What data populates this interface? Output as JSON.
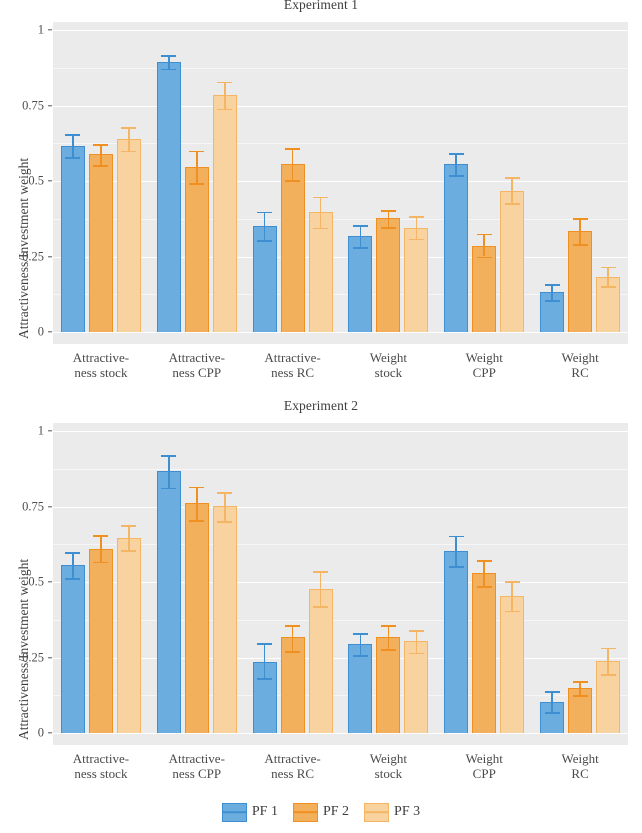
{
  "figure": {
    "panels": [
      {
        "title": "Experiment 1",
        "ylabel": "Attractiveness/Investment weight"
      },
      {
        "title": "Experiment 2",
        "ylabel": "Attractiveness/Investment weight"
      }
    ],
    "legend": {
      "items": [
        {
          "label": "PF 1",
          "color": "#6cade0",
          "border": "#3d8fd1"
        },
        {
          "label": "PF 2",
          "color": "#f2b05c",
          "border": "#ef9021"
        },
        {
          "label": "PF 3",
          "color": "#f8d3a0",
          "border": "#f4b665"
        }
      ]
    }
  },
  "chart_data": [
    {
      "type": "bar",
      "title": "Experiment 1",
      "xlabel": "",
      "ylabel": "Attractiveness/Investment weight",
      "ylim": [
        0,
        1
      ],
      "yticks": [
        0,
        0.25,
        0.5,
        0.75,
        1
      ],
      "ytick_labels": [
        "0",
        "0.25",
        "0.5",
        "0.75",
        "1"
      ],
      "grid": true,
      "legend_position": "bottom",
      "categories": [
        "Attractive-\nness stock",
        "Attractive-\nness CPP",
        "Attractive-\nness RC",
        "Weight\nstock",
        "Weight\nCPP",
        "Weight\nRC"
      ],
      "category_lines": [
        [
          "Attractive-",
          "ness stock"
        ],
        [
          "Attractive-",
          "ness CPP"
        ],
        [
          "Attractive-",
          "ness RC"
        ],
        [
          "Weight",
          "stock"
        ],
        [
          "Weight",
          "CPP"
        ],
        [
          "Weight",
          "RC"
        ]
      ],
      "series": [
        {
          "name": "PF 1",
          "color": "#6cade0",
          "border": "#3d8fd1",
          "values": [
            0.615,
            0.893,
            0.352,
            0.318,
            0.556,
            0.131
          ],
          "err_low": [
            0.578,
            0.872,
            0.303,
            0.281,
            0.519,
            0.105
          ],
          "err_high": [
            0.655,
            0.917,
            0.399,
            0.354,
            0.592,
            0.159
          ]
        },
        {
          "name": "PF 2",
          "color": "#f2b05c",
          "border": "#ef9021",
          "values": [
            0.589,
            0.547,
            0.556,
            0.377,
            0.286,
            0.334
          ],
          "err_low": [
            0.552,
            0.492,
            0.503,
            0.347,
            0.25,
            0.291
          ],
          "err_high": [
            0.622,
            0.6,
            0.609,
            0.404,
            0.325,
            0.377
          ]
        },
        {
          "name": "PF 3",
          "color": "#f8d3a0",
          "border": "#f4b665",
          "values": [
            0.639,
            0.784,
            0.397,
            0.346,
            0.468,
            0.183
          ],
          "err_low": [
            0.6,
            0.74,
            0.345,
            0.309,
            0.426,
            0.152
          ],
          "err_high": [
            0.678,
            0.829,
            0.448,
            0.384,
            0.512,
            0.216
          ]
        }
      ]
    },
    {
      "type": "bar",
      "title": "Experiment 2",
      "xlabel": "",
      "ylabel": "Attractiveness/Investment weight",
      "ylim": [
        0,
        1
      ],
      "yticks": [
        0,
        0.25,
        0.5,
        0.75,
        1
      ],
      "ytick_labels": [
        "0",
        "0.25",
        "0.5",
        "0.75",
        "1"
      ],
      "grid": true,
      "legend_position": "bottom",
      "categories": [
        "Attractive-\nness stock",
        "Attractive-\nness CPP",
        "Attractive-\nness RC",
        "Weight\nstock",
        "Weight\nCPP",
        "Weight\nRC"
      ],
      "category_lines": [
        [
          "Attractive-",
          "ness stock"
        ],
        [
          "Attractive-",
          "ness CPP"
        ],
        [
          "Attractive-",
          "ness RC"
        ],
        [
          "Weight",
          "stock"
        ],
        [
          "Weight",
          "CPP"
        ],
        [
          "Weight",
          "RC"
        ]
      ],
      "series": [
        {
          "name": "PF 1",
          "color": "#6cade0",
          "border": "#3d8fd1",
          "values": [
            0.556,
            0.866,
            0.236,
            0.295,
            0.601,
            0.104
          ],
          "err_low": [
            0.512,
            0.812,
            0.182,
            0.257,
            0.552,
            0.068
          ],
          "err_high": [
            0.598,
            0.92,
            0.298,
            0.331,
            0.653,
            0.139
          ]
        },
        {
          "name": "PF 2",
          "color": "#f2b05c",
          "border": "#ef9021",
          "values": [
            0.61,
            0.76,
            0.317,
            0.318,
            0.531,
            0.148
          ],
          "err_low": [
            0.567,
            0.705,
            0.271,
            0.278,
            0.487,
            0.126
          ],
          "err_high": [
            0.654,
            0.816,
            0.357,
            0.357,
            0.572,
            0.171
          ]
        },
        {
          "name": "PF 3",
          "color": "#f8d3a0",
          "border": "#f4b665",
          "values": [
            0.645,
            0.752,
            0.477,
            0.303,
            0.453,
            0.239
          ],
          "err_low": [
            0.605,
            0.701,
            0.419,
            0.266,
            0.405,
            0.194
          ],
          "err_high": [
            0.688,
            0.798,
            0.535,
            0.341,
            0.503,
            0.282
          ]
        }
      ]
    }
  ]
}
